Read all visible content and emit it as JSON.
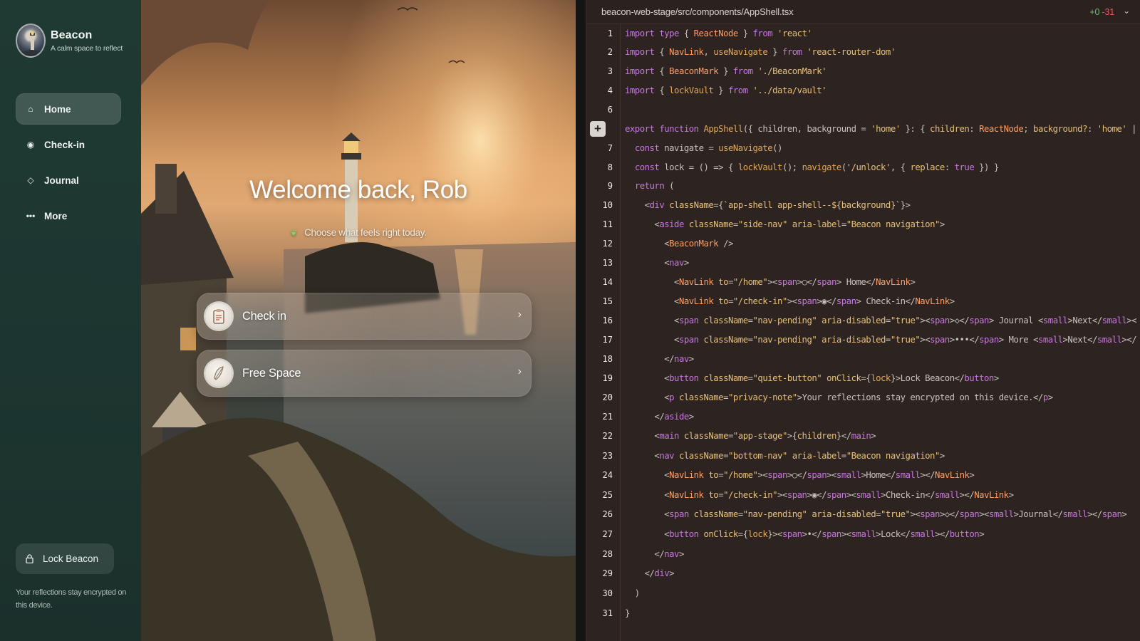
{
  "app": {
    "brand_name": "Beacon",
    "brand_tagline": "A calm space to reflect",
    "nav": [
      {
        "label": "Home",
        "icon": "home-icon",
        "active": true
      },
      {
        "label": "Check-in",
        "icon": "record-icon",
        "active": false
      },
      {
        "label": "Journal",
        "icon": "diamond-icon",
        "active": false
      },
      {
        "label": "More",
        "icon": "more-dots-icon",
        "active": false
      }
    ],
    "lock_label": "Lock Beacon",
    "privacy_note": "Your reflections stay encrypted on this device."
  },
  "stage": {
    "greeting": "Welcome back, Rob",
    "subline": "Choose what feels right today.",
    "cards": [
      {
        "label": "Check in",
        "icon": "clipboard-icon",
        "chevron": "›"
      },
      {
        "label": "Free Space",
        "icon": "feather-icon",
        "chevron": "›"
      }
    ]
  },
  "editor": {
    "file_path": "beacon-web-stage/src/components/AppShell.tsx",
    "diff_added": "+0",
    "diff_removed": "-31",
    "caret": "⌄",
    "line_numbers": [
      "1",
      "2",
      "3",
      "4",
      "6",
      "",
      "7",
      "8",
      "9",
      "10",
      "11",
      "12",
      "13",
      "14",
      "15",
      "16",
      "17",
      "18",
      "19",
      "20",
      "21",
      "22",
      "23",
      "24",
      "25",
      "26",
      "27",
      "28",
      "29",
      "30",
      "31"
    ],
    "colors": {
      "background": "#2d2320",
      "add": "#6fbf73",
      "remove": "#e06060"
    }
  }
}
